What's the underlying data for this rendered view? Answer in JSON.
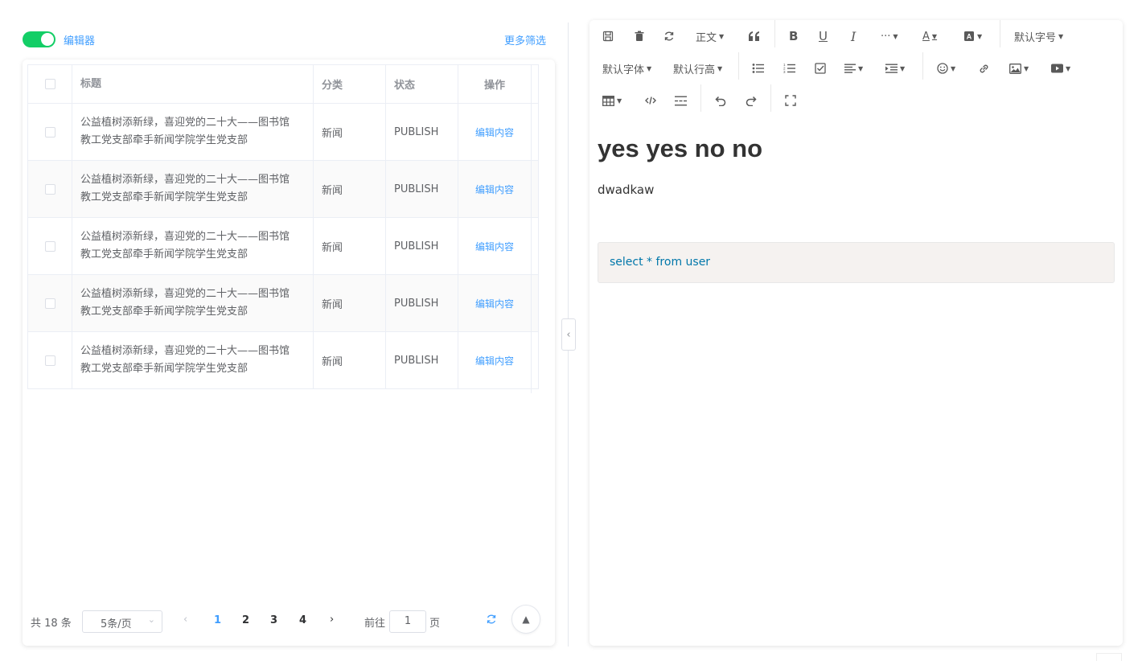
{
  "header": {
    "toggle_label": "编辑器",
    "toggle_on": true,
    "more_filter": "更多筛选"
  },
  "table": {
    "columns": [
      "标题",
      "分类",
      "状态",
      "操作"
    ],
    "rows": [
      {
        "title": "公益植树添新绿，喜迎党的二十大——图书馆教工党支部牵手新闻学院学生党支部",
        "category": "新闻",
        "status": "PUBLISH",
        "action": "编辑内容"
      },
      {
        "title": "公益植树添新绿，喜迎党的二十大——图书馆教工党支部牵手新闻学院学生党支部",
        "category": "新闻",
        "status": "PUBLISH",
        "action": "编辑内容"
      },
      {
        "title": "公益植树添新绿，喜迎党的二十大——图书馆教工党支部牵手新闻学院学生党支部",
        "category": "新闻",
        "status": "PUBLISH",
        "action": "编辑内容"
      },
      {
        "title": "公益植树添新绿，喜迎党的二十大——图书馆教工党支部牵手新闻学院学生党支部",
        "category": "新闻",
        "status": "PUBLISH",
        "action": "编辑内容"
      },
      {
        "title": "公益植树添新绿，喜迎党的二十大——图书馆教工党支部牵手新闻学院学生党支部",
        "category": "新闻",
        "status": "PUBLISH",
        "action": "编辑内容"
      }
    ]
  },
  "pagination": {
    "total": "共 18 条",
    "page_size": "5条/页",
    "pages": [
      "1",
      "2",
      "3",
      "4"
    ],
    "current_page": "1",
    "goto_prefix": "前往",
    "goto_value": "1",
    "goto_suffix": "页"
  },
  "toolbar": {
    "heading_select": "正文",
    "font_size_select": "默认字号",
    "font_family_select": "默认字体",
    "line_height_select": "默认行高"
  },
  "editor": {
    "heading": "yes yes no no",
    "paragraph": "dwadkaw",
    "code": "select * from user"
  },
  "colors": {
    "primary": "#409eff",
    "switch_on": "#13ce66",
    "code_bg": "#f5f2f0"
  }
}
